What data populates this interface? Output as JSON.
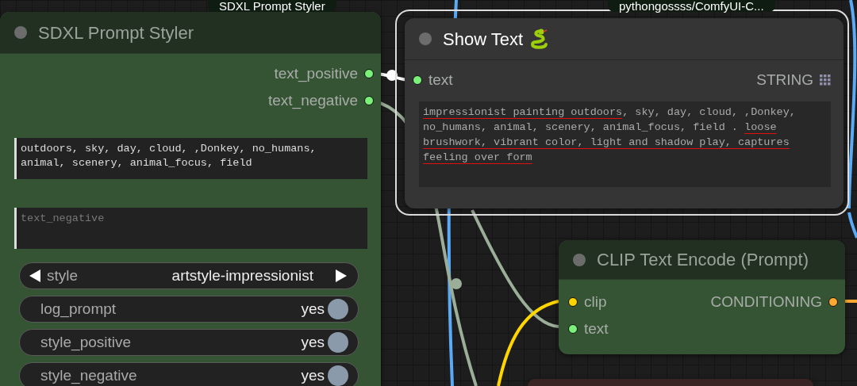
{
  "badges": [
    {
      "text": "SDXL Prompt Styler"
    },
    {
      "text": "pythongossss/ComfyUI-C..."
    }
  ],
  "styler_node": {
    "title": "SDXL Prompt Styler",
    "outputs": [
      {
        "name": "text_positive",
        "color": "#7af27a"
      },
      {
        "name": "text_negative",
        "color": "#7af27a"
      }
    ],
    "text_positive": {
      "value": "outdoors, sky, day, cloud, ,Donkey, no_humans, animal, scenery, animal_focus, field"
    },
    "text_negative": {
      "placeholder": "text_negative"
    },
    "style": {
      "label": "style",
      "value": "artstyle-impressionist"
    },
    "toggles": [
      {
        "label": "log_prompt",
        "value": "yes",
        "on": true
      },
      {
        "label": "style_positive",
        "value": "yes",
        "on": true
      },
      {
        "label": "style_negative",
        "value": "yes",
        "on": true
      }
    ]
  },
  "show_text_node": {
    "title": "Show Text",
    "selected": true,
    "input": {
      "name": "text",
      "color": "#7af27a",
      "type": "STRING"
    },
    "text": [
      {
        "text": "impressionist painting outdoors",
        "underlined": true
      },
      {
        "text": ", sky, day, cloud, ,Donkey, no_humans, animal, scenery, animal_focus, field . ",
        "underlined": false
      },
      {
        "text": "loose brushwork, vibrant color, light and shadow play, captures feeling over form",
        "underlined": true
      }
    ]
  },
  "clip_node": {
    "title": "CLIP Text Encode (Prompt)",
    "inputs": [
      {
        "name": "clip",
        "color": "#ffd500"
      },
      {
        "name": "text",
        "color": "#7af27a"
      }
    ],
    "outputs": [
      {
        "name": "CONDITIONING",
        "color": "#ffa931"
      }
    ]
  }
}
